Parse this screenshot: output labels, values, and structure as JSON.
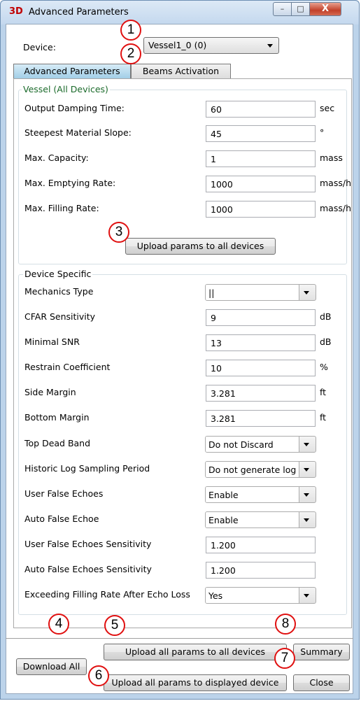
{
  "window": {
    "title": "Advanced Parameters",
    "app_icon": "3D",
    "min_glyph": "–",
    "max_glyph": "□",
    "close_glyph": "X"
  },
  "device": {
    "label": "Device:",
    "selected": "Vessel1_0 (0)"
  },
  "tabs": [
    {
      "label": "Advanced Parameters",
      "active": true
    },
    {
      "label": "Beams Activation",
      "active": false
    }
  ],
  "vessel": {
    "title": "Vessel (All Devices)",
    "fields": [
      {
        "label": "Output Damping Time:",
        "value": "60",
        "unit": "sec"
      },
      {
        "label": "Steepest Material Slope:",
        "value": "45",
        "unit": "°"
      },
      {
        "label": "Max. Capacity:",
        "value": "1",
        "unit": "mass"
      },
      {
        "label": "Max. Emptying Rate:",
        "value": "1000",
        "unit": "mass/h"
      },
      {
        "label": "Max. Filling Rate:",
        "value": "1000",
        "unit": "mass/h"
      }
    ],
    "upload_button": "Upload params to all devices"
  },
  "device_specific": {
    "title": "Device Specific",
    "fields": [
      {
        "label": "Mechanics Type",
        "value": "||",
        "kind": "combo",
        "unit": ""
      },
      {
        "label": "CFAR Sensitivity",
        "value": "9",
        "kind": "text",
        "unit": "dB"
      },
      {
        "label": "Minimal SNR",
        "value": "13",
        "kind": "text",
        "unit": "dB"
      },
      {
        "label": "Restrain Coefficient",
        "value": "10",
        "kind": "text",
        "unit": "%"
      },
      {
        "label": "Side Margin",
        "value": "3.281",
        "kind": "text",
        "unit": "ft"
      },
      {
        "label": "Bottom Margin",
        "value": "3.281",
        "kind": "text",
        "unit": "ft"
      },
      {
        "label": "Top Dead Band",
        "value": "Do not Discard",
        "kind": "combo",
        "unit": ""
      },
      {
        "label": "Historic Log Sampling Period",
        "value": "Do not generate log",
        "kind": "combo",
        "unit": ""
      },
      {
        "label": "User False Echoes",
        "value": "Enable",
        "kind": "combo",
        "unit": ""
      },
      {
        "label": "Auto False Echoe",
        "value": "Enable",
        "kind": "combo",
        "unit": ""
      },
      {
        "label": "User False Echoes Sensitivity",
        "value": "1.200",
        "kind": "text",
        "unit": ""
      },
      {
        "label": "Auto False Echoes Sensitivity",
        "value": "1.200",
        "kind": "text",
        "unit": ""
      },
      {
        "label": "Exceeding Filling Rate After Echo Loss",
        "value": "Yes",
        "kind": "combo",
        "unit": ""
      }
    ]
  },
  "footer": {
    "download_all": "Download All",
    "upload_all_to_all": "Upload all params to all devices",
    "upload_all_to_displayed": "Upload all params to displayed device",
    "summary": "Summary",
    "close": "Close"
  },
  "markers": [
    "1",
    "2",
    "3",
    "4",
    "5",
    "6",
    "7",
    "8"
  ],
  "colors": {
    "marker_ring": "#e01010",
    "active_tab": "#9fcde6",
    "vessel_title": "#1a6a2a"
  }
}
